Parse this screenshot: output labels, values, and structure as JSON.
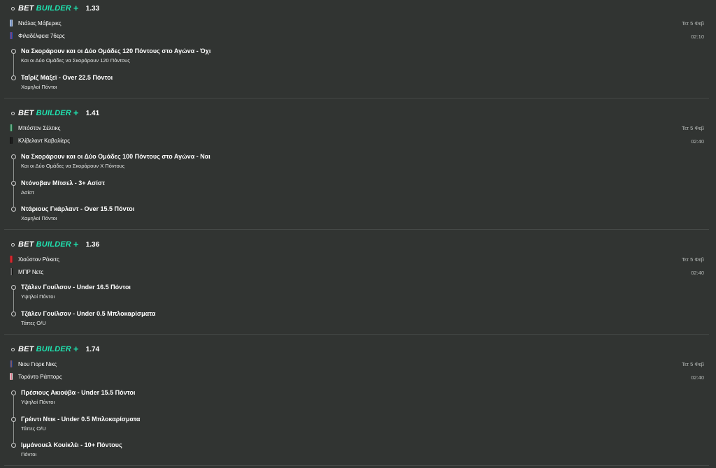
{
  "brand": {
    "bet": "BET",
    "builder": "BUILDER",
    "plus": "+"
  },
  "colors": {
    "background": "#313432",
    "accent": "#1fe3b0",
    "divider": "#454947",
    "muted": "#b9bdbb"
  },
  "bets": [
    {
      "odds": "1.33",
      "date": "Τετ 5 Φεβ",
      "time": "02:10",
      "home": {
        "name": "Ντάλας Μάβερικς",
        "jersey_icon": "jersey-icon"
      },
      "away": {
        "name": "Φιλαδέλφεια 76ερς",
        "jersey_icon": "jersey-icon"
      },
      "selections": [
        {
          "title": "Να Σκοράρουν και οι Δύο Ομάδες 120 Πόντους στο Αγώνα - Όχι",
          "market": "Και οι Δύο Ομάδες να Σκοράρουν 120 Πόντους"
        },
        {
          "title": "Ταΐρίζ Μάξεϊ - Over 22.5 Πόντοι",
          "market": "Χαμηλοί Πόντοι"
        }
      ]
    },
    {
      "odds": "1.41",
      "date": "Τετ 5 Φεβ",
      "time": "02:40",
      "home": {
        "name": "Μπόστον Σέλτικς",
        "jersey_icon": "jersey-icon"
      },
      "away": {
        "name": "Κλίβελαντ Καβαλίερς",
        "jersey_icon": "jersey-icon"
      },
      "selections": [
        {
          "title": "Να Σκοράρουν και οι Δύο Ομάδες 100 Πόντους στο Αγώνα - Ναι",
          "market": "Και οι Δύο Ομάδες να Σκοράρουν Χ Πόντους"
        },
        {
          "title": "Ντόνοβαν Μίτσελ - 3+ Ασίστ",
          "market": "Ασίστ"
        },
        {
          "title": "Ντάριους Γκάρλαντ - Over 15.5 Πόντοι",
          "market": "Χαμηλοί Πόντοι"
        }
      ]
    },
    {
      "odds": "1.36",
      "date": "Τετ 5 Φεβ",
      "time": "02:40",
      "home": {
        "name": "Χιούστον Ρόκετς",
        "jersey_icon": "jersey-icon"
      },
      "away": {
        "name": "ΜΠΡ Νετς",
        "jersey_icon": "jersey-icon"
      },
      "selections": [
        {
          "title": "Τζάλεν Γουίλσον - Under 16.5 Πόντοι",
          "market": "Υψηλοί Πόντοι"
        },
        {
          "title": "Τζάλεν Γουίλσον - Under 0.5 Μπλοκαρίσματα",
          "market": "Τάπες O/U"
        }
      ]
    },
    {
      "odds": "1.74",
      "date": "Τετ 5 Φεβ",
      "time": "02:40",
      "home": {
        "name": "Νιου Γιορκ Νικς",
        "jersey_icon": "jersey-icon"
      },
      "away": {
        "name": "Τορόντο Ράπτορς",
        "jersey_icon": "jersey-icon"
      },
      "selections": [
        {
          "title": "Πρέσιους Ακιούβα - Under 15.5 Πόντοι",
          "market": "Υψηλοί Πόντοι"
        },
        {
          "title": "Γρέιντι Ντικ - Under 0.5 Μπλοκαρίσματα",
          "market": "Τάπες O/U"
        },
        {
          "title": "Ιμμάνουελ Κουίκλέι - 10+ Πόντους",
          "market": "Πόντοι"
        }
      ]
    }
  ]
}
